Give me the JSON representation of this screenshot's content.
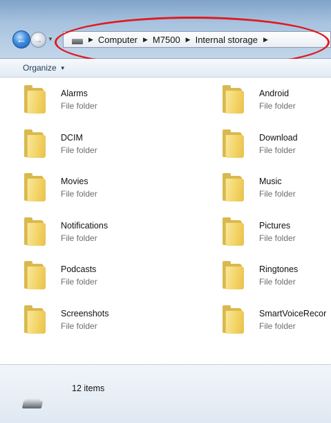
{
  "window": {
    "icons": {
      "back": "back-arrow-icon",
      "forward": "forward-arrow-icon",
      "drive": "portable-drive-icon",
      "device": "usb-device-icon",
      "folder": "folder-icon"
    },
    "annotation_color": "#e0191f"
  },
  "address": {
    "breadcrumbs": [
      {
        "label": "Computer"
      },
      {
        "label": "M7500"
      },
      {
        "label": "Internal storage"
      }
    ]
  },
  "toolbar": {
    "organize_label": "Organize"
  },
  "files": [
    {
      "name": "Alarms",
      "type": "File folder"
    },
    {
      "name": "Android",
      "type": "File folder"
    },
    {
      "name": "DCIM",
      "type": "File folder"
    },
    {
      "name": "Download",
      "type": "File folder"
    },
    {
      "name": "Movies",
      "type": "File folder"
    },
    {
      "name": "Music",
      "type": "File folder"
    },
    {
      "name": "Notifications",
      "type": "File folder"
    },
    {
      "name": "Pictures",
      "type": "File folder"
    },
    {
      "name": "Podcasts",
      "type": "File folder"
    },
    {
      "name": "Ringtones",
      "type": "File folder"
    },
    {
      "name": "Screenshots",
      "type": "File folder"
    },
    {
      "name": "SmartVoiceRecor",
      "type": "File folder"
    }
  ],
  "status": {
    "item_count": "12 items"
  }
}
